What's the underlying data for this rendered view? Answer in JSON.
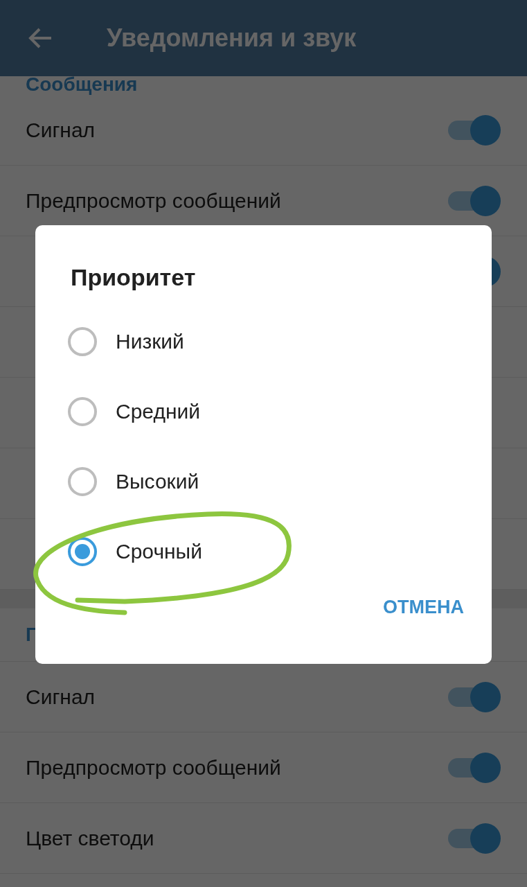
{
  "app_bar": {
    "title": "Уведомления и звук"
  },
  "sections": [
    {
      "title": "Сообщения",
      "items": [
        {
          "kind": "toggle",
          "label": "Сигнал",
          "on": true
        },
        {
          "kind": "toggle",
          "label": "Предпросмотр сообщений",
          "on": true
        },
        {
          "kind": "toggle",
          "on": true
        },
        {
          "kind": "value"
        },
        {
          "kind": "value"
        },
        {
          "kind": "value"
        },
        {
          "kind": "value"
        }
      ]
    },
    {
      "title": "Г",
      "items": [
        {
          "kind": "toggle",
          "label": "Сигнал",
          "on": true
        },
        {
          "kind": "toggle",
          "label": "Предпросмотр сообщений",
          "on": true
        },
        {
          "kind": "toggle",
          "label": "Цвет светоди",
          "on": true
        }
      ]
    }
  ],
  "dialog": {
    "title": "Приоритет",
    "options": [
      {
        "label": "Низкий",
        "selected": false
      },
      {
        "label": "Средний",
        "selected": false
      },
      {
        "label": "Высокий",
        "selected": false
      },
      {
        "label": "Срочный",
        "selected": true
      }
    ],
    "buttons": [
      "ОТМЕНА"
    ]
  }
}
